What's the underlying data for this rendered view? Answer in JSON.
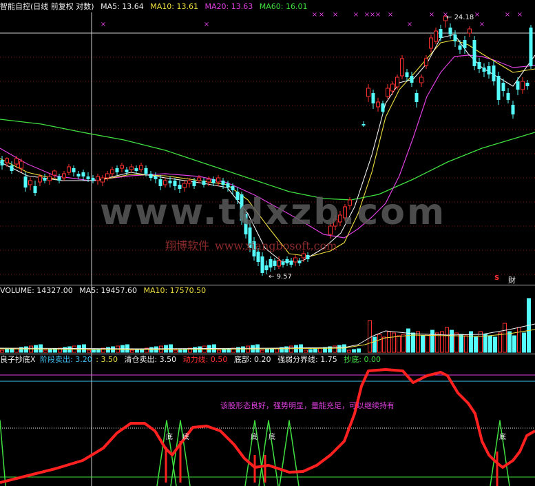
{
  "price_header": {
    "title": "智能自控(日线 前复权 对数)",
    "items": [
      {
        "text": "MA5: 13.64",
        "color": "#f0f0f0"
      },
      {
        "text": "MA10: 13.61",
        "color": "#f0e040"
      },
      {
        "text": "MA20: 13.63",
        "color": "#e040e0"
      },
      {
        "text": "MA60: 16.01",
        "color": "#40e040"
      }
    ]
  },
  "volume_header": {
    "items": [
      {
        "text": "VOLUME: 14327.00",
        "color": "#f0f0f0"
      },
      {
        "text": "MA5: 19457.60",
        "color": "#f0f0f0"
      },
      {
        "text": "MA10: 17570.50",
        "color": "#f0e040"
      }
    ]
  },
  "indicator_header": {
    "items": [
      {
        "text": "良子抄底X",
        "color": "#f0f0f0"
      },
      {
        "text": "阶段卖出: 3.20",
        "color": "#40c0f0"
      },
      {
        "text": ": 3.50",
        "color": "#f0e040"
      },
      {
        "text": "清仓卖出: 3.50",
        "color": "#f0f0f0"
      },
      {
        "text": "动力线: 0.50",
        "color": "#ff3030"
      },
      {
        "text": "底部: 0.20",
        "color": "#f0f0f0"
      },
      {
        "text": "强弱分界线: 1.75",
        "color": "#f0f0f0"
      },
      {
        "text": "抄底: 0.00",
        "color": "#40e040"
      }
    ]
  },
  "labels": {
    "high": "24.18",
    "low": "9.57",
    "s_mark": "S",
    "cai_mark": "财",
    "di_mark": "底",
    "sell_mark": "×"
  },
  "watermark": {
    "main": "www.tdxzb.com",
    "cn": "翔博软件",
    "url": "www.xiangbosoft.com"
  },
  "note": "该股形态良好，强势明显，量能充足，可以继续持有",
  "colors": {
    "up": "#ff3030",
    "down": "#54fcfc",
    "ma5": "#f0f0f0",
    "ma10": "#f0e040",
    "ma20": "#e040e0",
    "ma60": "#40e040",
    "power": "#ff2020",
    "chaodi": "#40e040"
  },
  "chart_data": {
    "type": "candlestick",
    "price_range": [
      9.0,
      25.5
    ],
    "scale": "log",
    "period_high": 24.18,
    "period_low": 9.57,
    "close_last": 13.64,
    "volume_last": 14327.0
  }
}
